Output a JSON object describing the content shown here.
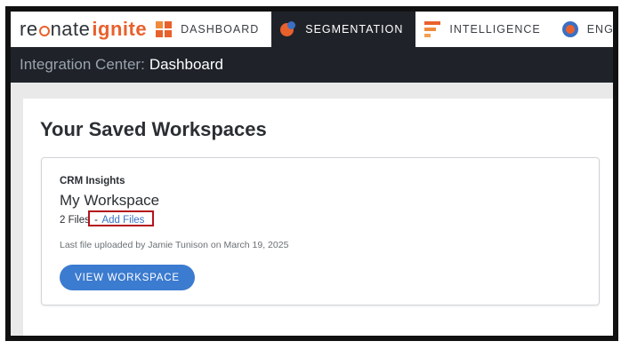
{
  "nav": {
    "logo": {
      "text_pre": "re",
      "text_post": "nate",
      "accent": "ignite"
    },
    "items": [
      {
        "label": "DASHBOARD",
        "icon": "dashboard-grid-icon",
        "active": false
      },
      {
        "label": "SEGMENTATION",
        "icon": "segmentation-icon",
        "active": true
      },
      {
        "label": "INTELLIGENCE",
        "icon": "intelligence-bars-icon",
        "active": false
      },
      {
        "label": "ENGA",
        "icon": "engagement-target-icon",
        "active": false
      }
    ]
  },
  "subheader": {
    "prefix": "Integration Center:",
    "title": "Dashboard"
  },
  "main": {
    "title": "Your Saved Workspaces",
    "workspace": {
      "category": "CRM Insights",
      "name": "My Workspace",
      "files_count": "2 Files",
      "separator": "-",
      "add_files_link": "Add Files",
      "last_upload": "Last file uploaded by Jamie Tunison on March 19, 2025",
      "view_button": "VIEW WORKSPACE"
    }
  },
  "colors": {
    "brand_orange": "#e8612c",
    "nav_dark": "#1f2329",
    "button_blue": "#3b7bd0",
    "link_blue": "#3a73c5",
    "highlight_red": "#b3141c"
  }
}
